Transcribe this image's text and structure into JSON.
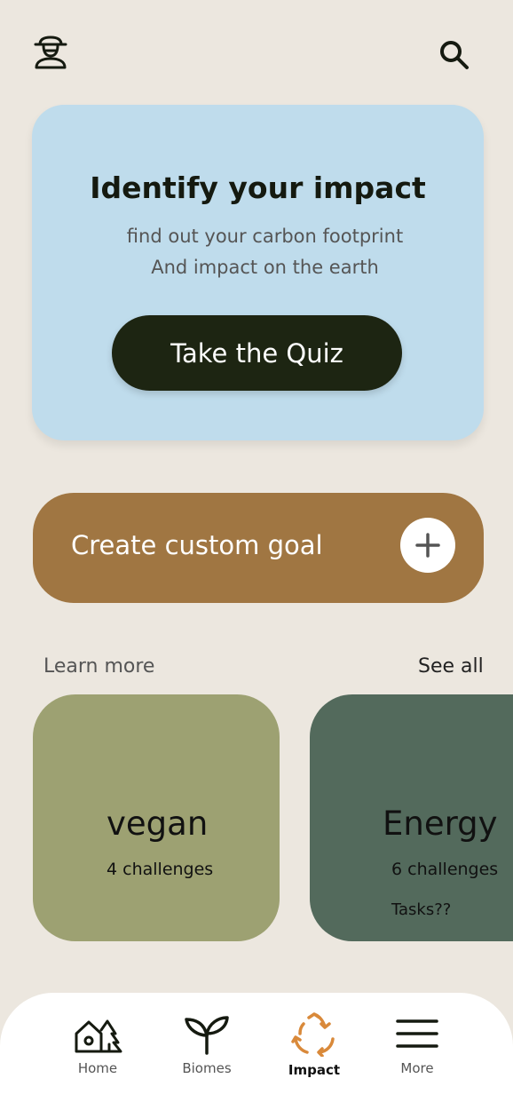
{
  "header": {
    "avatar_icon": "explorer-hat-icon",
    "search_icon": "search-icon"
  },
  "quiz": {
    "title": "Identify your impact",
    "subtitle_line1": "find out your carbon footprint",
    "subtitle_line2": "And impact on the earth",
    "button_label": "Take the Quiz",
    "bg_color": "#bfdcec",
    "button_color": "#1d2512"
  },
  "goal": {
    "label": "Create custom goal",
    "icon": "plus-icon",
    "bg_color": "#a07642"
  },
  "learn": {
    "heading": "Learn more",
    "see_all": "See all",
    "cards": [
      {
        "name": "vegan",
        "count": "4 challenges",
        "extra": "",
        "color": "#9da172"
      },
      {
        "name": "Energy",
        "count": "6 challenges",
        "extra": "Tasks??",
        "color": "#536a5c"
      }
    ]
  },
  "nav": {
    "items": [
      {
        "label": "Home",
        "icon": "home-forest-icon",
        "active": false
      },
      {
        "label": "Biomes",
        "icon": "sprout-icon",
        "active": false
      },
      {
        "label": "Impact",
        "icon": "recycle-icon",
        "active": true
      },
      {
        "label": "More",
        "icon": "menu-icon",
        "active": false
      }
    ],
    "accent": "#d9893a"
  }
}
